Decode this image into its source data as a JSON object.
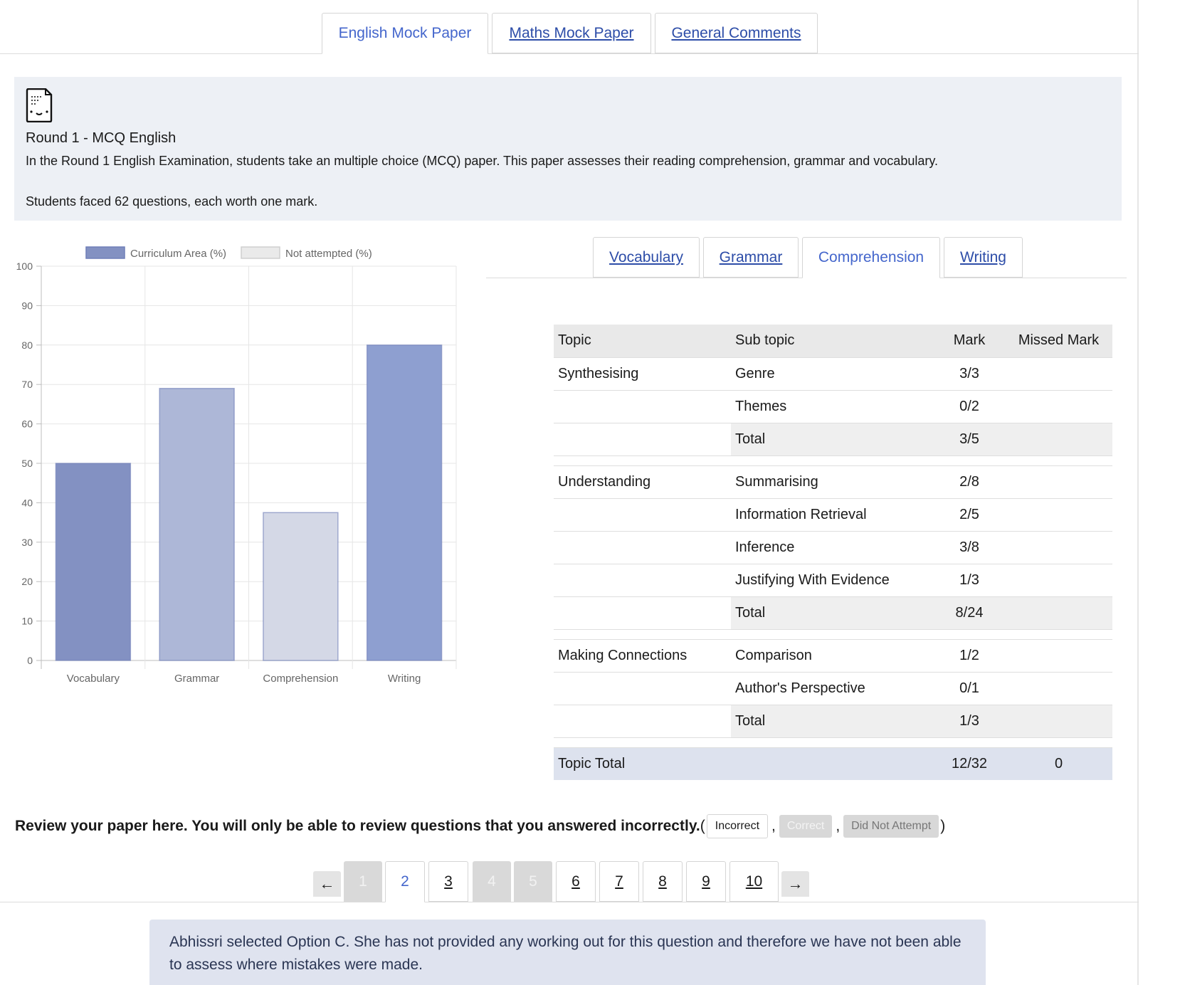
{
  "top_tabs": [
    {
      "label": "English Mock Paper",
      "active": true
    },
    {
      "label": "Maths Mock Paper",
      "active": false
    },
    {
      "label": "General Comments",
      "active": false
    }
  ],
  "info": {
    "icon": "document-icon",
    "title": "Round 1 - MCQ English",
    "description": "In the Round 1 English Examination, students take an multiple choice (MCQ) paper. This paper assesses their reading comprehension, grammar and vocabulary.",
    "note": "Students faced 62 questions, each worth one mark."
  },
  "chart_data": {
    "type": "bar",
    "title": "",
    "xlabel": "",
    "ylabel": "",
    "categories": [
      "Vocabulary",
      "Grammar",
      "Comprehension",
      "Writing"
    ],
    "values": [
      50,
      69,
      37.5,
      80
    ],
    "bar_colors": [
      "#8391c2",
      "#adb7d7",
      "#d4d8e6",
      "#8e9fd0"
    ],
    "ylim": [
      0,
      100
    ],
    "yticks": [
      0,
      10,
      20,
      30,
      40,
      50,
      60,
      70,
      80,
      90,
      100
    ],
    "grid": true,
    "legend_position": "top",
    "legend": [
      {
        "name": "Curriculum Area (%)",
        "color": "#8391c2"
      },
      {
        "name": "Not attempted (%)",
        "color": "#eaeaea"
      }
    ]
  },
  "sub_tabs": [
    {
      "label": "Vocabulary",
      "active": false
    },
    {
      "label": "Grammar",
      "active": false
    },
    {
      "label": "Comprehension",
      "active": true
    },
    {
      "label": "Writing",
      "active": false
    }
  ],
  "table": {
    "headers": {
      "topic": "Topic",
      "sub": "Sub topic",
      "mark": "Mark",
      "missed": "Missed Mark"
    },
    "groups": [
      {
        "topic": "Synthesising",
        "rows": [
          {
            "sub": "Genre",
            "mark": "3/3"
          },
          {
            "sub": "Themes",
            "mark": "0/2"
          }
        ],
        "total_label": "Total",
        "total": "3/5"
      },
      {
        "topic": "Understanding",
        "rows": [
          {
            "sub": "Summarising",
            "mark": "2/8"
          },
          {
            "sub": "Information Retrieval",
            "mark": "2/5"
          },
          {
            "sub": "Inference",
            "mark": "3/8"
          },
          {
            "sub": "Justifying With Evidence",
            "mark": "1/3"
          }
        ],
        "total_label": "Total",
        "total": "8/24"
      },
      {
        "topic": "Making Connections",
        "rows": [
          {
            "sub": "Comparison",
            "mark": "1/2"
          },
          {
            "sub": "Author's Perspective",
            "mark": "0/1"
          }
        ],
        "total_label": "Total",
        "total": "1/3"
      }
    ],
    "grand": {
      "label": "Topic Total",
      "mark": "12/32",
      "missed": "0"
    }
  },
  "review": {
    "text": "Review your paper here. You will only be able to review questions that you answered incorrectly.",
    "open": "(",
    "close": ")",
    "sep": ",",
    "incorrect": "Incorrect",
    "correct": "Correct",
    "did_not_attempt": "Did Not Attempt"
  },
  "pager": {
    "prev": "←",
    "next": "→",
    "pages": [
      {
        "label": "1",
        "state": "disabled"
      },
      {
        "label": "2",
        "state": "active"
      },
      {
        "label": "3",
        "state": "link"
      },
      {
        "label": "4",
        "state": "disabled"
      },
      {
        "label": "5",
        "state": "disabled"
      },
      {
        "label": "6",
        "state": "link"
      },
      {
        "label": "7",
        "state": "link"
      },
      {
        "label": "8",
        "state": "link"
      },
      {
        "label": "9",
        "state": "link"
      },
      {
        "label": "10",
        "state": "link"
      }
    ]
  },
  "feedback": "Abhissri selected Option C. She has not provided any working out for this question and therefore we have not been able to assess where mistakes were made."
}
